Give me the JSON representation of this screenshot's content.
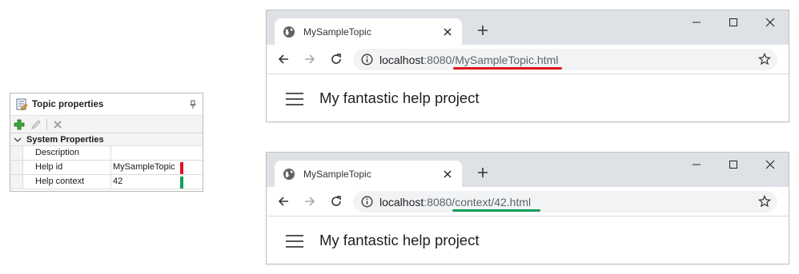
{
  "topic_panel": {
    "title": "Topic properties",
    "toolbar": {
      "add_icon": "add-icon",
      "edit_icon": "pencil-icon",
      "delete_icon": "delete-icon"
    },
    "category": "System Properties",
    "properties": [
      {
        "name": "Description",
        "value": ""
      },
      {
        "name": "Help id",
        "value": "MySampleTopic",
        "marker_color": "#e0141c"
      },
      {
        "name": "Help context",
        "value": "42",
        "marker_color": "#0fa05a"
      }
    ]
  },
  "browsers": [
    {
      "tab_title": "MySampleTopic",
      "url_host": "localhost",
      "url_rest": ":8080/MySampleTopic.html",
      "heading": "My fantastic help project",
      "underline_color": "#e0141c"
    },
    {
      "tab_title": "MySampleTopic",
      "url_host": "localhost",
      "url_rest": ":8080/context/42.html",
      "heading": "My fantastic help project",
      "underline_color": "#0fa05a"
    }
  ]
}
